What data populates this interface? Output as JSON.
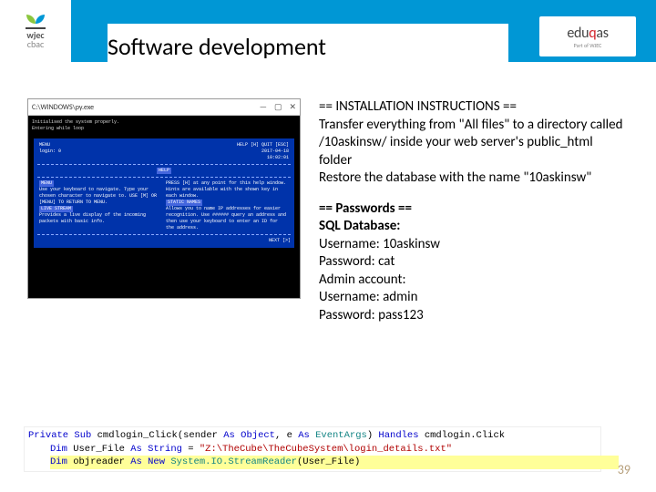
{
  "header": {
    "wjec_line1": "wjec",
    "wjec_line2": "cbac",
    "title": "Software development",
    "eduqas": "eduqas",
    "eduqas_sub": "Part of WJEC"
  },
  "terminal": {
    "titlebar": "C:\\WINDOWS\\py.exe",
    "line1": "Initialised the system properly.",
    "line2": "Entering while loop",
    "menu": "MENU",
    "login": "login: 0",
    "topright1": "HELP [H]   QUIT [ESC]",
    "topright2": "2017-04-18",
    "topright3": "10:02:01",
    "help_header": "HELP",
    "col1_title": "MENU",
    "col1_body": "Use your keyboard to navigate. Type your chosen character to navigate to. USE [M] OR [MENU] TO RETURN TO MENU.",
    "col1_title2": "LIVE STREAM",
    "col1_body2": "Provides a live display of the incoming packets with basic info.",
    "col2_body": "PRESS [H] at any point for this help window. Hints are available with the shown key in each window.",
    "col2_title": "STATIC NAMES",
    "col2_body2": "Allows you to name IP addresses for easier recognition. Use ###### query an address and then use your keyboard to enter an ID for the address.",
    "next": "NEXT [>]"
  },
  "notes": {
    "install_header": "== INSTALLATION INSTRUCTIONS ==",
    "install_body": "Transfer everything from \"All files\" to a directory called /10askinsw/ inside your web server's public_html folder",
    "install_restore": "Restore the database with the name \"10askinsw\"",
    "pw_header": "== Passwords ==",
    "sql": "SQL Database:",
    "sql_user": "Username: 10askinsw",
    "sql_pass": "Password: cat",
    "admin": "Admin account:",
    "admin_user": "Username: admin",
    "admin_pass": "Password: pass123"
  },
  "code": {
    "l1_kw1": "Private Sub",
    "l1_name": " cmdlogin_Click(sender ",
    "l1_kw2": "As",
    "l1_obj": " Object",
    "l1_mid": ", e ",
    "l1_kw3": "As",
    "l1_cls": " EventArgs",
    "l1_end": ") ",
    "l1_kw4": "Handles",
    "l1_h": " cmdlogin.Click",
    "l2_kw1": "Dim",
    "l2_name": " User_File ",
    "l2_kw2": "As String",
    "l2_eq": " = ",
    "l2_str": "\"Z:\\TheCube\\TheCubeSystem\\login_details.txt\"",
    "l3_kw1": "Dim",
    "l3_name": " objreader ",
    "l3_kw2": "As New",
    "l3_cls": " System.IO.StreamReader",
    "l3_end": "(User_File)"
  },
  "page_number": "39"
}
